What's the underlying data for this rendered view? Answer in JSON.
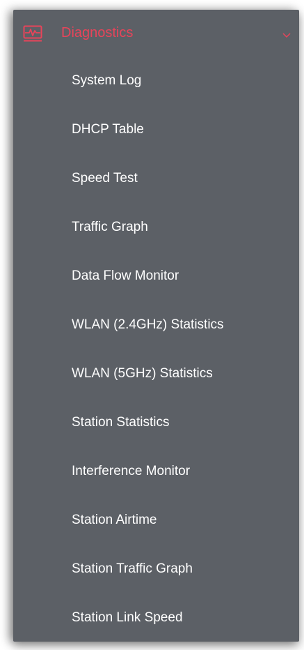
{
  "menu": {
    "title": "Diagnostics",
    "icon": "pulse-monitor-icon",
    "expand_icon": "chevron-down-icon",
    "accent_color": "#e8445a",
    "background_color": "#5c6066",
    "items": [
      {
        "label": "System Log"
      },
      {
        "label": "DHCP Table"
      },
      {
        "label": "Speed Test"
      },
      {
        "label": "Traffic Graph"
      },
      {
        "label": "Data Flow Monitor"
      },
      {
        "label": "WLAN (2.4GHz) Statistics"
      },
      {
        "label": "WLAN (5GHz) Statistics"
      },
      {
        "label": "Station Statistics"
      },
      {
        "label": "Interference Monitor"
      },
      {
        "label": "Station Airtime"
      },
      {
        "label": "Station Traffic Graph"
      },
      {
        "label": "Station Link Speed"
      }
    ]
  }
}
